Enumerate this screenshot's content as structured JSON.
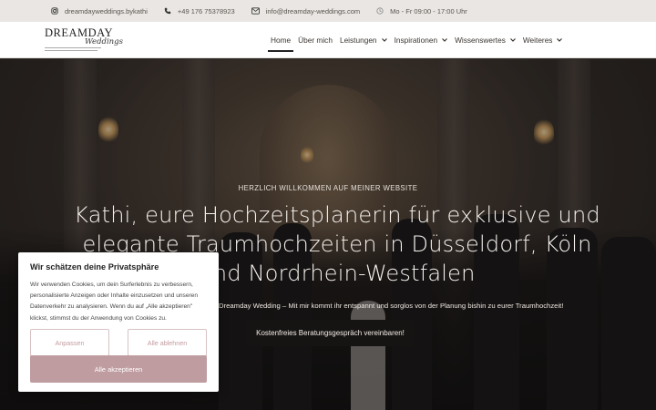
{
  "topbar": {
    "instagram": "dreamdayweddings.bykathi",
    "phone": "+49 176 75378923",
    "email": "info@dreamday-weddings.com",
    "hours": "Mo - Fr 09:00 - 17:00 Uhr"
  },
  "logo": {
    "word": "DREAMDAY",
    "script": "Weddings"
  },
  "nav": {
    "items": [
      {
        "label": "Home",
        "active": true
      },
      {
        "label": "Über mich"
      },
      {
        "label": "Leistungen",
        "dropdown": true
      },
      {
        "label": "Inspirationen",
        "dropdown": true
      },
      {
        "label": "Wissenswertes",
        "dropdown": true
      },
      {
        "label": "Weiteres",
        "dropdown": true
      }
    ]
  },
  "hero": {
    "kicker": "HERZLICH WILLKOMMEN AUF MEINER WEBSITE",
    "headline": "Kathi, eure Hochzeitsplanerin für exklusive und elegante Traumhochzeiten in Düsseldorf, Köln und Nordrhein-Westfalen",
    "subline": "Dreamday Wedding – Mit mir kommt ihr entspannt und sorglos von der Planung bishin zu eurer Traumhochzeit!",
    "cta": "Kostenfreies Beratungsgespräch vereinbaren!"
  },
  "cookie": {
    "title": "Wir schätzen deine Privatsphäre",
    "text": "Wir verwenden Cookies, um dein Surferlebnis zu verbessern, personalisierte Anzeigen oder Inhalte einzusetzen und unseren Datenverkehr zu analysieren. Wenn du auf „Alle akzeptieren\" klickst, stimmst du der Anwendung von Cookies zu.",
    "customize": "Anpassen",
    "reject": "Alle ablehnen",
    "accept": "Alle akzeptieren"
  },
  "colors": {
    "accent": "#bf9ca0",
    "topbar_bg": "#e9e6e3",
    "cta_bg": "#161413"
  }
}
